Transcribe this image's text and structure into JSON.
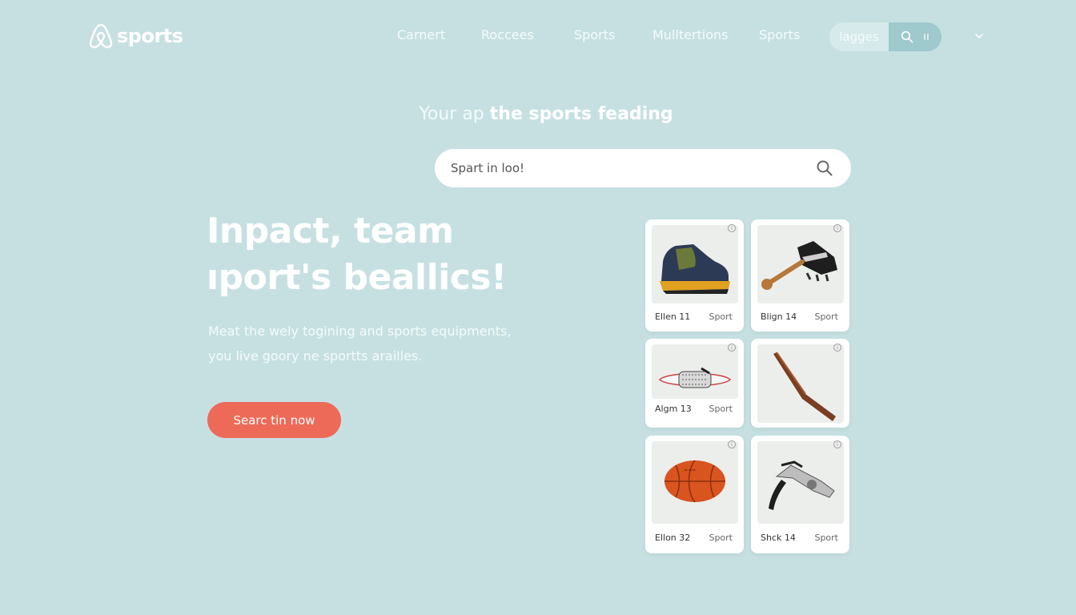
{
  "brand": {
    "name": "sports",
    "logo_icon": "airbnb-style-logo-icon"
  },
  "nav": {
    "items": [
      "Carnert",
      "Roccees",
      "Sports",
      "Mulltertions",
      "Sports"
    ],
    "pill_label": "lagges",
    "pill_icons": [
      "search-icon",
      "menu-icon"
    ],
    "pill_menu_glyph": "ıı"
  },
  "tagline": {
    "light": "Your ap ",
    "bold": "the sports feading"
  },
  "search": {
    "placeholder": "Spart in loo!"
  },
  "hero": {
    "title_line1": "Inpact, team",
    "title_line2": "ıport's beallics!",
    "subtitle_line1": "Meat the wely togining and sports equipments,",
    "subtitle_line2": "you live goory ne sportts arailles.",
    "cta_label": "Searc tin now"
  },
  "products": [
    {
      "name": "Ellen 11",
      "tag": "Sport",
      "image": "hiking-shoe-image"
    },
    {
      "name": "Blign 14",
      "tag": "Sport",
      "image": "cleat-shoe-image"
    },
    {
      "name": "Algm 13",
      "tag": "Sport",
      "image": "skateboard-image"
    },
    {
      "name": "",
      "tag": "",
      "image": "hockey-stick-image"
    },
    {
      "name": "Ellon 32",
      "tag": "Sport",
      "image": "football-image"
    },
    {
      "name": "Shck 14",
      "tag": "Sport",
      "image": "bike-part-image"
    }
  ],
  "colors": {
    "background": "#c6e0e2",
    "accent": "#ee6a58",
    "pill": "#9ec9cd"
  }
}
